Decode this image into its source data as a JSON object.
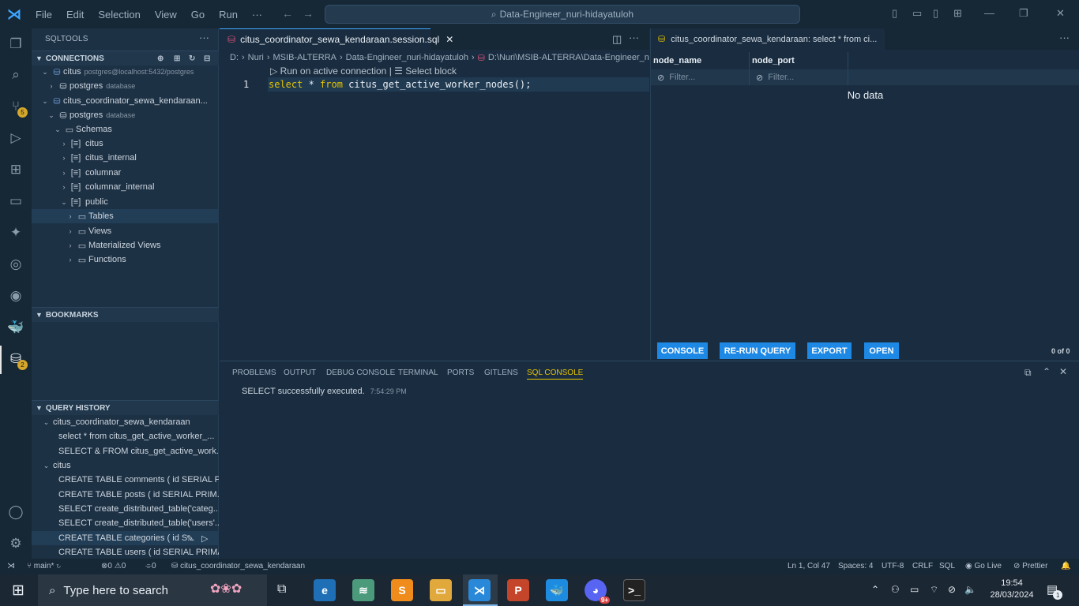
{
  "titlebar": {
    "menu": [
      "File",
      "Edit",
      "Selection",
      "View",
      "Go",
      "Run",
      "···"
    ],
    "search_text": "Data-Engineer_nuri-hidayatuloh"
  },
  "activity": {
    "scm_badge": "5",
    "sqltools_badge": "2"
  },
  "sidebar": {
    "title": "SQLTOOLS",
    "connections_header": "CONNECTIONS",
    "tree": [
      {
        "label": "citus",
        "sub": "postgres@localhost:5432/postgres"
      },
      {
        "label": "postgres",
        "sub": "database"
      },
      {
        "label": "citus_coordinator_sewa_kendaraan..."
      },
      {
        "label": "postgres",
        "sub": "database"
      },
      {
        "label": "Schemas"
      },
      {
        "label": "citus"
      },
      {
        "label": "citus_internal"
      },
      {
        "label": "columnar"
      },
      {
        "label": "columnar_internal"
      },
      {
        "label": "public"
      },
      {
        "label": "Tables"
      },
      {
        "label": "Views"
      },
      {
        "label": "Materialized Views"
      },
      {
        "label": "Functions"
      }
    ],
    "bookmarks_header": "BOOKMARKS",
    "history_header": "QUERY HISTORY",
    "history": [
      "citus_coordinator_sewa_kendaraan",
      "select * from citus_get_active_worker_...",
      "SELECT & FROM citus_get_active_work...",
      "citus",
      "CREATE TABLE comments ( id SERIAL P...",
      "CREATE TABLE posts ( id SERIAL PRIM...",
      "SELECT create_distributed_table('categ...",
      "SELECT create_distributed_table('users'...",
      "CREATE TABLE categories ( id S...",
      "CREATE TABLE users ( id SERIAL PRIMA..."
    ]
  },
  "editor": {
    "tab_label": "citus_coordinator_sewa_kendaraan.session.sql",
    "breadcrumb": [
      "D:",
      "Nuri",
      "MSIB-ALTERRA",
      "Data-Engineer_nuri-hidayatuloh",
      "D:\\Nuri\\MSIB-ALTERRA\\Data-Engineer_nuri"
    ],
    "codelens_run": "Run on active connection",
    "codelens_sep": "|",
    "codelens_select": "Select block",
    "line_number": "1",
    "code_kw1": "select",
    "code_star": " * ",
    "code_kw2": "from",
    "code_fn": " citus_get_active_worker_nodes();"
  },
  "results": {
    "tab_label": "citus_coordinator_sewa_kendaraan: select * from ci...",
    "columns": [
      "node_name",
      "node_port"
    ],
    "filter_placeholder": "Filter...",
    "empty_text": "No data",
    "buttons": [
      "CONSOLE",
      "RE-RUN QUERY",
      "EXPORT",
      "OPEN"
    ],
    "count": "0 of 0"
  },
  "panel": {
    "tabs": [
      "PROBLEMS",
      "OUTPUT",
      "DEBUG CONSOLE",
      "TERMINAL",
      "PORTS",
      "GITLENS",
      "SQL CONSOLE"
    ],
    "message": "SELECT successfully executed.",
    "message_time": "7:54:29 PM"
  },
  "statusbar": {
    "branch": "main*",
    "errors": "0",
    "warnings": "0",
    "ports": "0",
    "connection": "citus_coordinator_sewa_kendaraan",
    "position": "Ln 1, Col 47",
    "spaces": "Spaces: 4",
    "encoding": "UTF-8",
    "eol": "CRLF",
    "language": "SQL",
    "golive": "Go Live",
    "prettier": "Prettier"
  },
  "taskbar": {
    "search_placeholder": "Type here to search",
    "time": "19:54",
    "date": "28/03/2024",
    "notif_count": "1",
    "discord_badge": "9+"
  }
}
